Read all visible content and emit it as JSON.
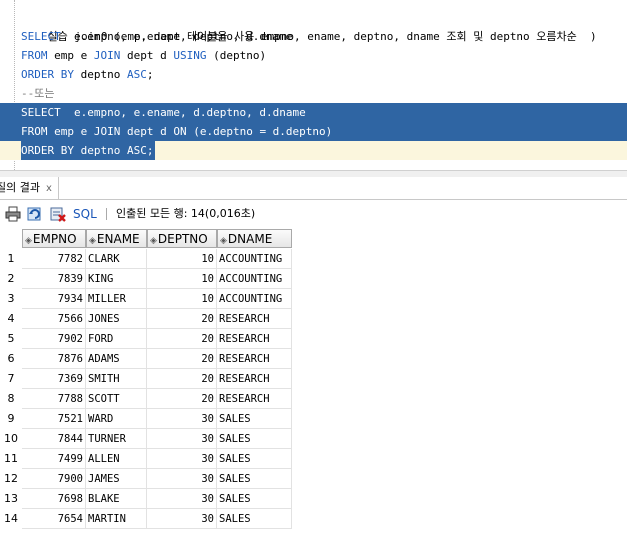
{
  "editor": {
    "lines": [
      {
        "type": "comment_ko",
        "text": "실습 join0 (emp, dept 테이블을 사용 empno, ename, deptno, dname 조회 및 deptno 오름차순  )"
      },
      {
        "type": "code",
        "kw": "SELECT",
        "rest": "  e.empno, e.ename, deptno, d.dname"
      },
      {
        "type": "code",
        "kw": "FROM",
        "rest": " emp e ",
        "kw2": "JOIN",
        "rest2": " dept d ",
        "kw3": "USING",
        "rest3": " (deptno)"
      },
      {
        "type": "code",
        "kw": "ORDER BY",
        "rest": " deptno ",
        "kw2": "ASC",
        "rest2": ";"
      },
      {
        "type": "comment",
        "text": "--또는"
      },
      {
        "type": "code",
        "kw": "SELECT",
        "rest": "  e.empno, e.ename, d.deptno, d.dname"
      },
      {
        "type": "code",
        "kw": "FROM",
        "rest": " emp e ",
        "kw2": "JOIN",
        "rest2": " dept d ",
        "kw3": "ON",
        "rest3": " (e.deptno = d.deptno)"
      },
      {
        "type": "code",
        "kw": "ORDER BY",
        "rest": " deptno ",
        "kw2": "ASC",
        "rest2": ";"
      }
    ]
  },
  "results_tab": {
    "label": "질의 결과",
    "close": "x"
  },
  "toolbar": {
    "sql_label": "SQL",
    "status": "인출된 모든 행: 14(0,016초)"
  },
  "grid": {
    "columns": [
      "EMPNO",
      "ENAME",
      "DEPTNO",
      "DNAME"
    ],
    "rows": [
      [
        "1",
        "7782",
        "CLARK",
        "10",
        "ACCOUNTING"
      ],
      [
        "2",
        "7839",
        "KING",
        "10",
        "ACCOUNTING"
      ],
      [
        "3",
        "7934",
        "MILLER",
        "10",
        "ACCOUNTING"
      ],
      [
        "4",
        "7566",
        "JONES",
        "20",
        "RESEARCH"
      ],
      [
        "5",
        "7902",
        "FORD",
        "20",
        "RESEARCH"
      ],
      [
        "6",
        "7876",
        "ADAMS",
        "20",
        "RESEARCH"
      ],
      [
        "7",
        "7369",
        "SMITH",
        "20",
        "RESEARCH"
      ],
      [
        "8",
        "7788",
        "SCOTT",
        "20",
        "RESEARCH"
      ],
      [
        "9",
        "7521",
        "WARD",
        "30",
        "SALES"
      ],
      [
        "10",
        "7844",
        "TURNER",
        "30",
        "SALES"
      ],
      [
        "11",
        "7499",
        "ALLEN",
        "30",
        "SALES"
      ],
      [
        "12",
        "7900",
        "JAMES",
        "30",
        "SALES"
      ],
      [
        "13",
        "7698",
        "BLAKE",
        "30",
        "SALES"
      ],
      [
        "14",
        "7654",
        "MARTIN",
        "30",
        "SALES"
      ]
    ]
  },
  "colors": {
    "keyword": "#1f5fbf",
    "selection": "#2f65a3",
    "current_line": "#fbf6dd",
    "sql_link": "#1a56b8"
  },
  "icons": [
    "print-icon",
    "refresh-sql-icon",
    "clear-results-icon"
  ]
}
